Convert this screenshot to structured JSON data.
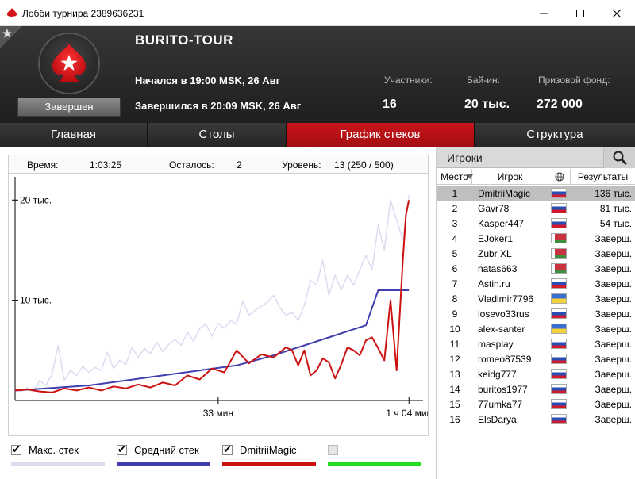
{
  "window": {
    "title": "Лобби турнира 2389636231"
  },
  "tournament": {
    "name": "BURITO-TOUR",
    "status": "Завершен",
    "started": "Начался в 19:00 MSK, 26 Авг",
    "ended": "Завершился в 20:09 MSK, 26 Авг",
    "participants_label": "Участники:",
    "participants": "16",
    "buyin_label": "Бай-ин:",
    "buyin": "20 тыс.",
    "prize_label": "Призовой фонд:",
    "prize": "272 000"
  },
  "tabs": [
    {
      "label": "Главная",
      "active": false
    },
    {
      "label": "Столы",
      "active": false
    },
    {
      "label": "График стеков",
      "active": true
    },
    {
      "label": "Структура",
      "active": false
    }
  ],
  "info": {
    "time_label": "Время:",
    "time": "1:03:25",
    "left_label": "Осталось:",
    "left": "2",
    "level_label": "Уровень:",
    "level": "13 (250 / 500)"
  },
  "chart_data": {
    "type": "line",
    "x_unit": "minutes",
    "xlim": [
      0,
      65
    ],
    "ylim": [
      0,
      22000
    ],
    "y_ticks": [
      {
        "value": 10000,
        "label": "10 тыс."
      },
      {
        "value": 20000,
        "label": "20 тыс."
      }
    ],
    "x_ticks": [
      {
        "value": 33,
        "label": "33 мин"
      },
      {
        "value": 64,
        "label": "1 ч 04 мин"
      }
    ],
    "series": [
      {
        "name": "Макс. стек",
        "color": "#dcdcf0",
        "x": [
          0,
          1,
          2,
          3,
          4,
          5,
          6,
          7,
          8,
          9,
          10,
          11,
          12,
          13,
          14,
          15,
          16,
          17,
          18,
          19,
          20,
          21,
          22,
          23,
          24,
          25,
          26,
          27,
          28,
          29,
          30,
          31,
          32,
          33,
          34,
          35,
          36,
          37,
          38,
          39,
          40,
          41,
          42,
          43,
          44,
          45,
          46,
          47,
          48,
          49,
          50,
          51,
          52,
          53,
          54,
          55,
          56,
          57,
          58,
          59,
          60,
          61,
          62,
          63,
          64
        ],
        "y": [
          1000,
          900,
          1300,
          900,
          2000,
          1500,
          2600,
          5500,
          2000,
          3000,
          2500,
          3400,
          2800,
          3300,
          3000,
          4800,
          3200,
          4000,
          3600,
          5300,
          4300,
          5200,
          4700,
          5800,
          4900,
          5600,
          6100,
          5500,
          6800,
          5900,
          7200,
          7600,
          6400,
          7700,
          7200,
          8000,
          7600,
          9900,
          8500,
          9000,
          9400,
          9800,
          10500,
          9300,
          8500,
          8800,
          8000,
          9500,
          12000,
          11500,
          14000,
          10500,
          12500,
          11000,
          12500,
          11500,
          13000,
          14500,
          13000,
          17500,
          15000,
          20000,
          18000,
          16000,
          20500
        ]
      },
      {
        "name": "Средний стек",
        "color": "#3f3fb0",
        "x": [
          0,
          6,
          12,
          18,
          24,
          30,
          36,
          42,
          48,
          57,
          59,
          60,
          61,
          62,
          63,
          64
        ],
        "y": [
          1000,
          1250,
          1500,
          2000,
          2500,
          3000,
          3500,
          4500,
          5700,
          7500,
          11000,
          11000,
          11000,
          11000,
          11000,
          11000
        ]
      },
      {
        "name": "DmitriiMagic",
        "color": "#cc1111",
        "x": [
          0,
          2,
          4,
          6,
          8,
          10,
          12,
          14,
          16,
          18,
          20,
          22,
          24,
          26,
          28,
          30,
          32,
          34,
          36,
          38,
          40,
          42,
          44,
          45,
          46,
          47,
          48,
          49,
          50,
          51,
          52,
          53,
          54,
          55,
          56,
          57,
          58,
          59,
          60,
          61,
          62,
          63,
          63.5,
          64
        ],
        "y": [
          1000,
          1100,
          900,
          800,
          1200,
          1000,
          1300,
          1000,
          1400,
          1200,
          1600,
          1300,
          1800,
          1500,
          2500,
          2100,
          3200,
          2800,
          5000,
          3700,
          4600,
          4300,
          5300,
          5000,
          3500,
          5000,
          2500,
          3000,
          4200,
          3800,
          2200,
          3600,
          5300,
          5000,
          4500,
          6000,
          6300,
          5200,
          4000,
          10000,
          3000,
          14000,
          18500,
          20000
        ]
      },
      {
        "name": "",
        "color": "#22dd22",
        "x": [],
        "y": []
      }
    ]
  },
  "legend": [
    {
      "label": "Макс. стек",
      "checked": true,
      "color": "#dcdcf0"
    },
    {
      "label": "Средний стек",
      "checked": true,
      "color": "#3f3fb0"
    },
    {
      "label": "DmitriiMagic",
      "checked": true,
      "color": "#cc1111"
    },
    {
      "label": "",
      "checked": false,
      "color": "#22dd22"
    }
  ],
  "players_panel": {
    "title": "Игроки",
    "col_place": "Место",
    "col_player": "Игрок",
    "col_results": "Результаты",
    "rows": [
      {
        "place": "1",
        "name": "DmitriiMagic",
        "flag": "ru",
        "result": "136 тыс.",
        "selected": true
      },
      {
        "place": "2",
        "name": "Gavr78",
        "flag": "ru",
        "result": "81 тыс."
      },
      {
        "place": "3",
        "name": "Kasper447",
        "flag": "ru",
        "result": "54 тыс."
      },
      {
        "place": "4",
        "name": "EJoker1",
        "flag": "by",
        "result": "Заверш."
      },
      {
        "place": "5",
        "name": "Zubr XL",
        "flag": "by",
        "result": "Заверш."
      },
      {
        "place": "6",
        "name": "natas663",
        "flag": "by",
        "result": "Заверш."
      },
      {
        "place": "7",
        "name": "Astin.ru",
        "flag": "ru",
        "result": "Заверш."
      },
      {
        "place": "8",
        "name": "Vladimir7796",
        "flag": "ua",
        "result": "Заверш."
      },
      {
        "place": "9",
        "name": "losevo33rus",
        "flag": "ru",
        "result": "Заверш."
      },
      {
        "place": "10",
        "name": "alex-santer",
        "flag": "ua",
        "result": "Заверш."
      },
      {
        "place": "11",
        "name": "masplay",
        "flag": "ru",
        "result": "Заверш."
      },
      {
        "place": "12",
        "name": "romeo87539",
        "flag": "ru",
        "result": "Заверш."
      },
      {
        "place": "13",
        "name": "keidg777",
        "flag": "ru",
        "result": "Заверш."
      },
      {
        "place": "14",
        "name": "buritos1977",
        "flag": "ru",
        "result": "Заверш."
      },
      {
        "place": "15",
        "name": "77umka77",
        "flag": "ru",
        "result": "Заверш."
      },
      {
        "place": "16",
        "name": "ElsDarya",
        "flag": "ru",
        "result": "Заверш."
      }
    ]
  }
}
